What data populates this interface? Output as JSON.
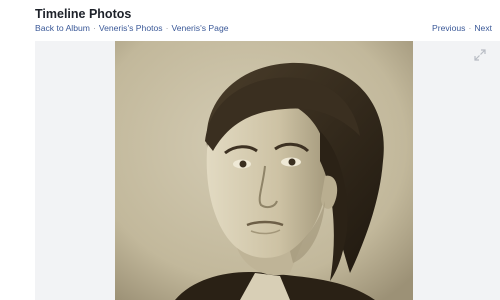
{
  "header": {
    "title": "Timeline Photos",
    "breadcrumb": {
      "back_link": "Back to Album",
      "photos_link": "Veneris's Photos",
      "page_link": "Veneris's Page",
      "separator": "·"
    },
    "pager": {
      "previous": "Previous",
      "next": "Next",
      "separator": "·"
    }
  },
  "viewer": {
    "expand_icon": "fullscreen-icon",
    "photo_subject": "sepia-portrait"
  },
  "colors": {
    "link": "#3b5998",
    "stage_bg": "#f2f3f5",
    "sepia_light": "#ccc2a8",
    "sepia_dark": "#2a2115"
  }
}
